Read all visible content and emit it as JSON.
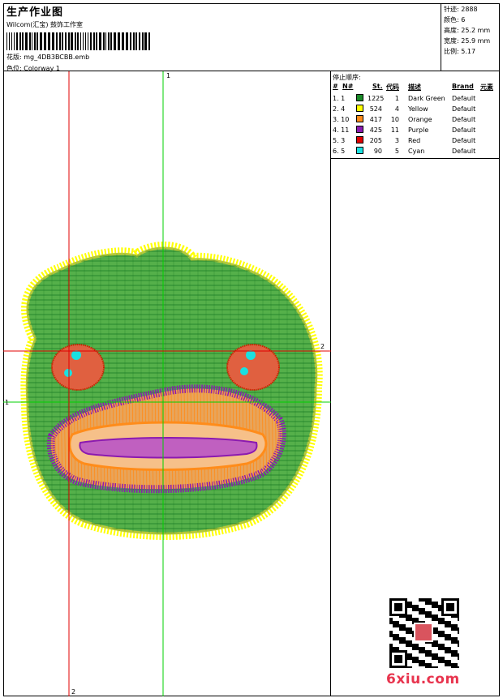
{
  "header": {
    "title": "生产作业图",
    "subtitle": "Wilcom(汇宝) 鼓饰工作室",
    "design_label": "花版:",
    "design_file": "mg_4DB3BCBB.emb",
    "colorway_label": "色位:",
    "colorway": "Colorway 1"
  },
  "stats": {
    "stitches": "针迹: 2888",
    "colors": "颜色: 6",
    "height": "高度: 25.2 mm",
    "width": "宽度: 25.9 mm",
    "scale": "比例: 5.17"
  },
  "stop_sequence": {
    "title": "停止顺序:",
    "headers": [
      "#",
      "N#",
      "St.",
      "代码",
      "描述",
      "Brand",
      "元素"
    ],
    "rows": [
      {
        "idx": "1. 1",
        "color": "#1a8a28",
        "stitches": "1225",
        "code": "1",
        "desc": "Dark Green",
        "brand": "Default"
      },
      {
        "idx": "2. 4",
        "color": "#ffff00",
        "stitches": "524",
        "code": "4",
        "desc": "Yellow",
        "brand": "Default"
      },
      {
        "idx": "3. 10",
        "color": "#ff8c1a",
        "stitches": "417",
        "code": "10",
        "desc": "Orange",
        "brand": "Default"
      },
      {
        "idx": "4. 11",
        "color": "#8b1ab0",
        "stitches": "425",
        "code": "11",
        "desc": "Purple",
        "brand": "Default"
      },
      {
        "idx": "5. 3",
        "color": "#e00000",
        "stitches": "205",
        "code": "3",
        "desc": "Red",
        "brand": "Default"
      },
      {
        "idx": "6. 5",
        "color": "#1ae0e0",
        "stitches": "90",
        "code": "5",
        "desc": "Cyan",
        "brand": "Default"
      }
    ]
  },
  "guides": {
    "v1": "1",
    "h2": "2",
    "h1": "1",
    "v2": "2"
  },
  "watermark": "6xiu.com"
}
